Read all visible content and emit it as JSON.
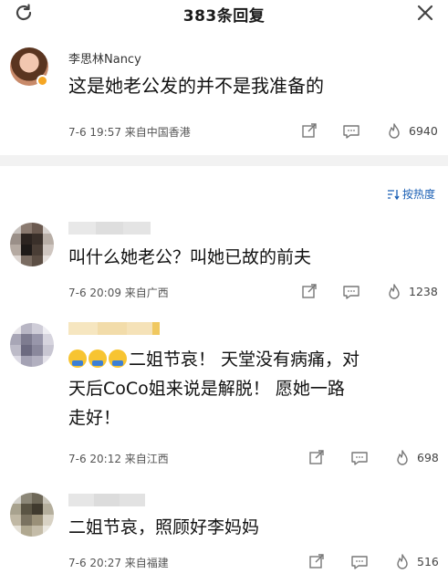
{
  "header": {
    "title": "383条回复",
    "refresh_icon": "refresh-icon",
    "close_icon": "close-icon"
  },
  "main_comment": {
    "author": "李思林Nancy",
    "text": "这是她老公发的并不是我准备的",
    "time_location": "7-6 19:57 来自中国香港",
    "likes": "6940",
    "badge_color": "#f5a623"
  },
  "sort": {
    "icon": "sort-icon",
    "label": "按热度"
  },
  "replies": [
    {
      "text": "叫什么她老公？叫她已故的前夫",
      "time_location": "7-6 20:09 来自广西",
      "likes": "1238"
    },
    {
      "text_line1": "二姐节哀！ 天堂没有病痛，对",
      "text_line2": "天后CoCo姐来说是解脱！ 愿她一路",
      "text_line3": "走好！",
      "time_location": "7-6 20:12 来自江西",
      "likes": "698"
    },
    {
      "text": "二姐节哀，照顾好李妈妈",
      "time_location": "7-6 20:27 来自福建",
      "likes": "516"
    }
  ],
  "colors": {
    "accent": "#1a5fb4",
    "meta_text": "#555555",
    "divider": "#f2f2f2"
  }
}
